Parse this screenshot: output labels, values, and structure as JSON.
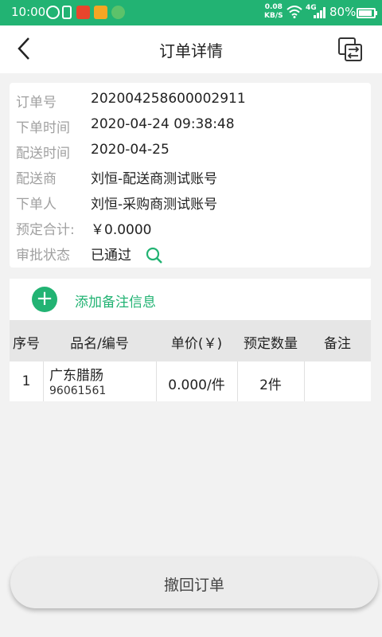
{
  "status_bar": {
    "time": "10:00",
    "net_speed_value": "0.08",
    "net_speed_unit": "KB/S",
    "signal_type": "4G",
    "battery": "80%"
  },
  "header": {
    "title": "订单详情",
    "back_icon": "chevron-left-icon",
    "switch_icon": "switch-arrows-icon"
  },
  "order": {
    "rows": [
      {
        "label": "订单号",
        "value": "202004258600002911"
      },
      {
        "label": "下单时间",
        "value": "2020-04-24 09:38:48"
      },
      {
        "label": "配送时间",
        "value": "2020-04-25"
      },
      {
        "label": "配送商",
        "value": "刘恒-配送商测试账号"
      },
      {
        "label": "下单人",
        "value": "刘恒-采购商测试账号"
      },
      {
        "label": "预定合计:",
        "value": "￥0.0000"
      },
      {
        "label": "审批状态",
        "value": "已通过"
      }
    ]
  },
  "remark": {
    "label": "添加备注信息",
    "icon": "plus-icon"
  },
  "table": {
    "headers": [
      "序号",
      "品名/编号",
      "单价(￥)",
      "预定数量",
      "备注"
    ],
    "rows": [
      {
        "index": "1",
        "name": "广东腊肠",
        "code": "96061561",
        "price": "0.000/件",
        "qty": "2件",
        "note": ""
      }
    ]
  },
  "footer": {
    "revoke_label": "撤回订单"
  },
  "colors": {
    "accent": "#22b373",
    "background": "#f2f2f2",
    "header_row": "#e6e6e6"
  }
}
